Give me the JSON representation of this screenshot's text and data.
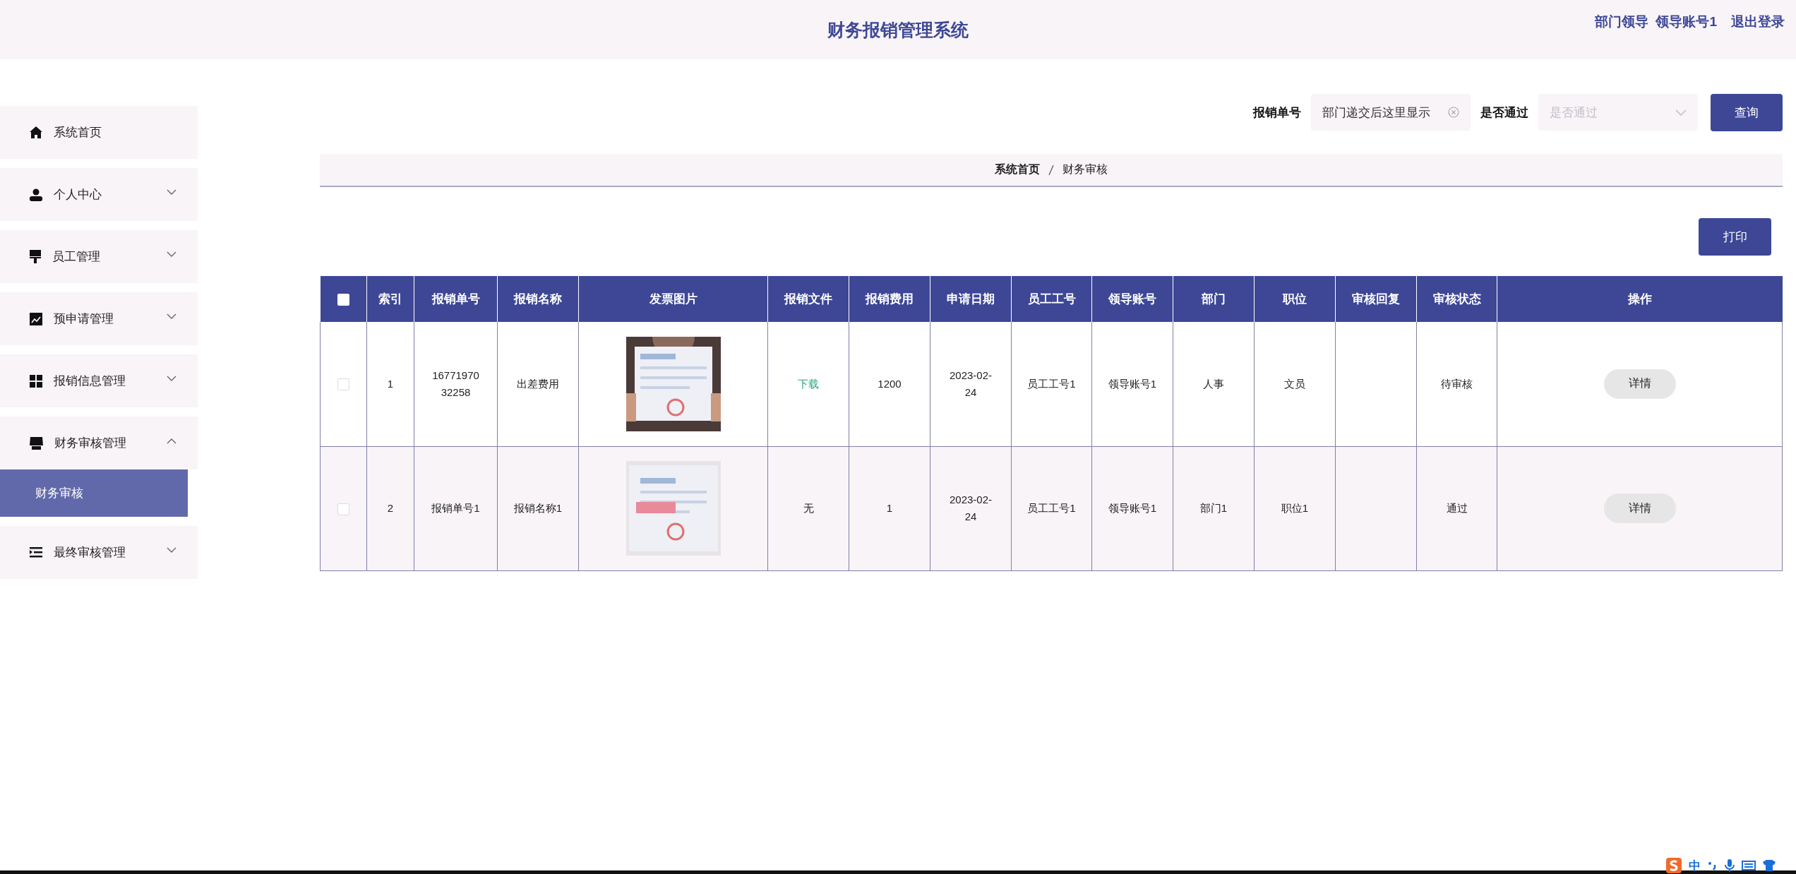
{
  "header": {
    "title": "财务报销管理系统",
    "role": "部门领导",
    "user": "领导账号1",
    "logout": "退出登录"
  },
  "sidebar": {
    "items": [
      {
        "label": "系统首页"
      },
      {
        "label": "个人中心",
        "expanded": false
      },
      {
        "label": "员工管理",
        "expanded": false
      },
      {
        "label": "预申请管理",
        "expanded": false
      },
      {
        "label": "报销信息管理",
        "expanded": false
      },
      {
        "label": "财务审核管理",
        "expanded": true,
        "children": [
          {
            "label": "财务审核",
            "selected": true
          }
        ]
      },
      {
        "label": "最终审核管理",
        "expanded": false
      }
    ]
  },
  "search": {
    "fields": [
      {
        "label": "报销单号",
        "kind": "input",
        "value": "部门递交后这里显示"
      },
      {
        "label": "是否通过",
        "kind": "select",
        "placeholder": "是否通过"
      }
    ],
    "button": "查询"
  },
  "breadcrumb": [
    "系统首页",
    "财务审核"
  ],
  "print_button": "打印",
  "table": {
    "columns": [
      {
        "kind": "checkbox",
        "checked": false
      },
      {
        "label": "索引"
      },
      {
        "label": "报销单号"
      },
      {
        "label": "报销名称"
      },
      {
        "label": "发票图片"
      },
      {
        "label": "报销文件"
      },
      {
        "label": "报销费用"
      },
      {
        "label": "申请日期"
      },
      {
        "label": "员工工号"
      },
      {
        "label": "领导账号"
      },
      {
        "label": "部门"
      },
      {
        "label": "职位"
      },
      {
        "label": "审核回复"
      },
      {
        "label": "审核状态"
      },
      {
        "label": "操作"
      }
    ],
    "rows": [
      {
        "cells": [
          {
            "kind": "checkbox",
            "checked": false
          },
          {
            "kind": "text",
            "text": "1"
          },
          {
            "kind": "text",
            "text": "1677197032258"
          },
          {
            "kind": "text",
            "text": "出差费用"
          },
          {
            "kind": "picture"
          },
          {
            "kind": "link",
            "text": "下载"
          },
          {
            "kind": "text",
            "text": "1200"
          },
          {
            "kind": "text",
            "text": "2023-02-24"
          },
          {
            "kind": "text",
            "text": "员工工号1"
          },
          {
            "kind": "text",
            "text": "领导账号1"
          },
          {
            "kind": "text",
            "text": "人事"
          },
          {
            "kind": "text",
            "text": "文员"
          },
          {
            "kind": "empty"
          },
          {
            "kind": "text",
            "text": "待审核"
          },
          {
            "kind": "button",
            "text": "详情"
          }
        ]
      },
      {
        "cells": [
          {
            "kind": "checkbox",
            "checked": false
          },
          {
            "kind": "text",
            "text": "2"
          },
          {
            "kind": "text",
            "text": "报销单号1"
          },
          {
            "kind": "text",
            "text": "报销名称1"
          },
          {
            "kind": "picture"
          },
          {
            "kind": "text",
            "text": "无"
          },
          {
            "kind": "text",
            "text": "1"
          },
          {
            "kind": "text",
            "text": "2023-02-24"
          },
          {
            "kind": "text",
            "text": "员工工号1"
          },
          {
            "kind": "text",
            "text": "领导账号1"
          },
          {
            "kind": "text",
            "text": "部门1"
          },
          {
            "kind": "text",
            "text": "职位1"
          },
          {
            "kind": "empty"
          },
          {
            "kind": "text",
            "text": "通过"
          },
          {
            "kind": "button",
            "text": "详情"
          }
        ]
      }
    ]
  },
  "tray": {
    "ime": "中"
  }
}
